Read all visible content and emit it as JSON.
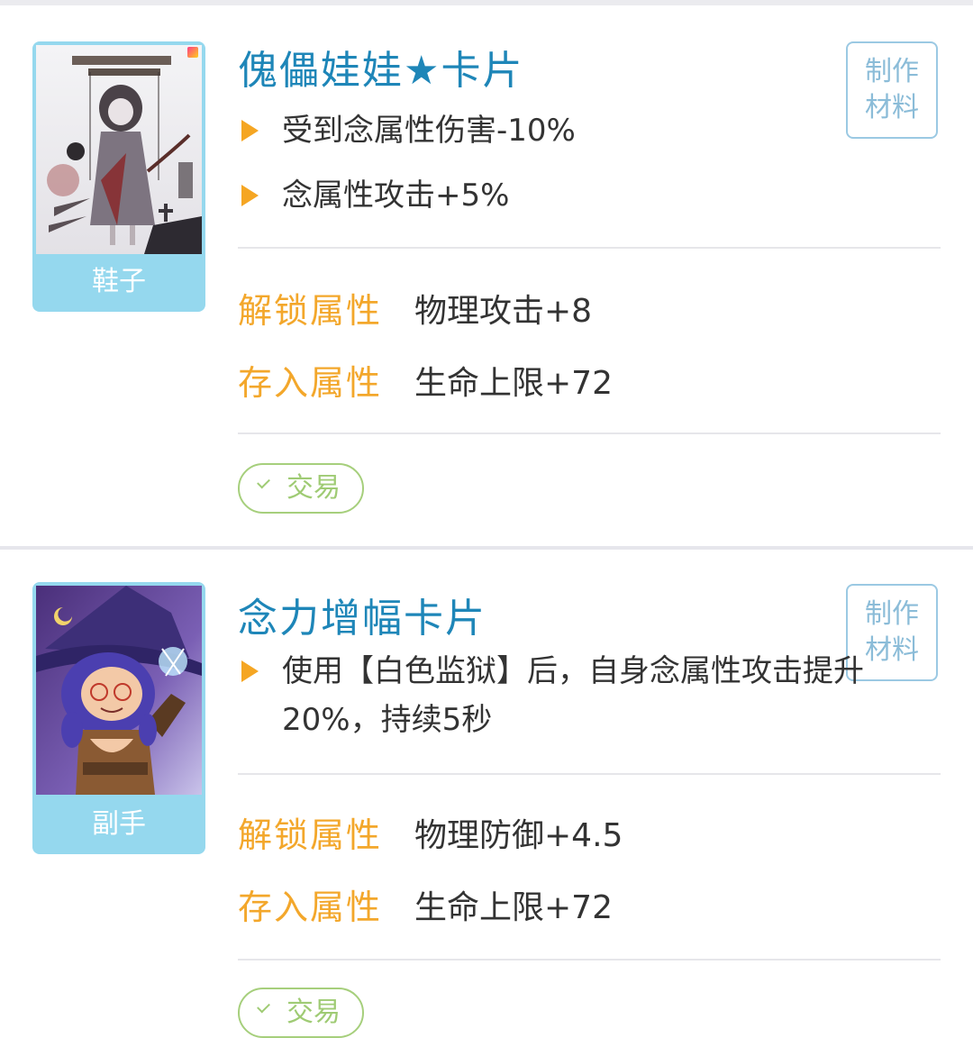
{
  "cards": [
    {
      "title": "傀儡娃娃★卡片",
      "slot": "鞋子",
      "make_label_1": "制作",
      "make_label_2": "材料",
      "effects": [
        "受到念属性伤害-10%",
        "念属性攻击+5%"
      ],
      "unlock_label": "解锁属性",
      "unlock_value": "物理攻击+8",
      "store_label": "存入属性",
      "store_value": "生命上限+72",
      "trade_label": "交易"
    },
    {
      "title": "念力增幅卡片",
      "slot": "副手",
      "make_label_1": "制作",
      "make_label_2": "材料",
      "effects": [
        "使用【白色监狱】后，自身念属性攻击提升20%，持续5秒"
      ],
      "unlock_label": "解锁属性",
      "unlock_value": "物理防御+4.5",
      "store_label": "存入属性",
      "store_value": "生命上限+72",
      "trade_label": "交易"
    }
  ],
  "colors": {
    "title": "#1e86b8",
    "label": "#f3a72b",
    "bullet": "#f5a623",
    "slot_bg": "#95d8ee",
    "trade": "#a6cf7c"
  }
}
